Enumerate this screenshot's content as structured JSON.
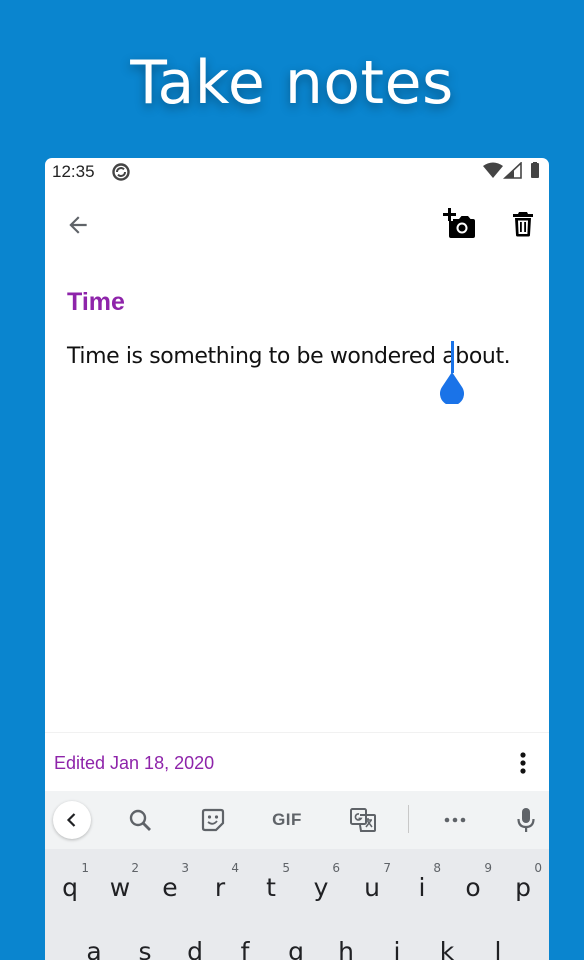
{
  "headline": "Take notes",
  "status_bar": {
    "time": "12:35",
    "icons": [
      "sync-icon",
      "wifi-icon",
      "signal-icon",
      "battery-icon"
    ]
  },
  "app_bar": {
    "icons": [
      "back-arrow-icon",
      "add-photo-icon",
      "trash-icon"
    ]
  },
  "note": {
    "title": "Time",
    "body": "Time is something to be wondered about."
  },
  "footer": {
    "edited": "Edited Jan 18, 2020"
  },
  "keyboard": {
    "toolbar": {
      "gif_label": "GIF",
      "icons": [
        "chevron-left-icon",
        "search-icon",
        "sticker-icon",
        "translate-icon",
        "more-horizontal-icon",
        "microphone-icon"
      ]
    },
    "row1": [
      {
        "letter": "q",
        "hint": "1"
      },
      {
        "letter": "w",
        "hint": "2"
      },
      {
        "letter": "e",
        "hint": "3"
      },
      {
        "letter": "r",
        "hint": "4"
      },
      {
        "letter": "t",
        "hint": "5"
      },
      {
        "letter": "y",
        "hint": "6"
      },
      {
        "letter": "u",
        "hint": "7"
      },
      {
        "letter": "i",
        "hint": "8"
      },
      {
        "letter": "o",
        "hint": "9"
      },
      {
        "letter": "p",
        "hint": "0"
      }
    ],
    "row2": [
      "a",
      "s",
      "d",
      "f",
      "g",
      "h",
      "j",
      "k",
      "l"
    ]
  },
  "colors": {
    "background": "#0a85cf",
    "accent": "#8e24aa",
    "cursor": "#1a73e8"
  }
}
